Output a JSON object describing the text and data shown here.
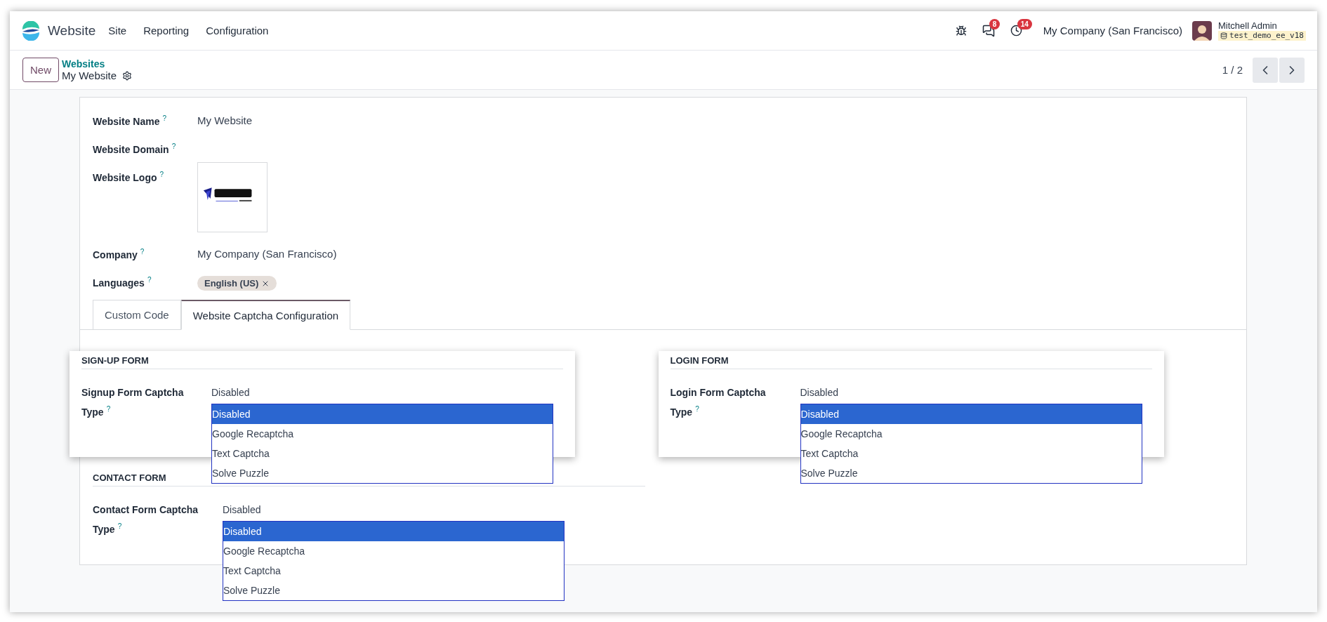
{
  "navbar": {
    "app_name": "Website",
    "menu": [
      "Site",
      "Reporting",
      "Configuration"
    ],
    "messages_badge": "8",
    "activities_badge": "14",
    "company": "My Company (San Francisco)",
    "user": {
      "name": "Mitchell Admin",
      "database": "test_demo_ee_v18"
    }
  },
  "control_panel": {
    "new_button": "New",
    "breadcrumb": "Websites",
    "record": "My Website",
    "pager": "1 / 2"
  },
  "fields": [
    {
      "kind": "text",
      "label": "Website Name",
      "help": "?",
      "value": "My Website"
    },
    {
      "kind": "text",
      "label": "Website Domain",
      "help": "?"
    },
    {
      "label": "Website Logo",
      "help": "?"
    },
    {
      "kind": "text",
      "label": "Company",
      "help": "?",
      "value": "My Company (San Francisco)"
    },
    {
      "kind": "tags",
      "label": "Languages",
      "help": "?",
      "tags": [
        "English (US)"
      ]
    }
  ],
  "tabs": [
    {
      "label": "Custom Code",
      "selected": false
    },
    {
      "label": "Website Captcha Configuration",
      "selected": true
    }
  ],
  "sections": [
    {
      "title": "SIGN-UP FORM",
      "raised": true,
      "label": "Signup Form Captcha",
      "label_end": "Type",
      "help": "?",
      "value": "Disabled",
      "options": [
        {
          "label": "Disabled",
          "selected": true
        },
        {
          "label": "Google Recaptcha",
          "selected": false
        },
        {
          "label": "Text Captcha",
          "selected": false
        },
        {
          "label": "Solve Puzzle",
          "selected": false
        }
      ]
    },
    {
      "title": "LOGIN FORM",
      "raised": true,
      "label": "Login Form Captcha",
      "label_end": "Type",
      "help": "?",
      "value": "Disabled",
      "options": [
        {
          "label": "Disabled",
          "selected": true
        },
        {
          "label": "Google Recaptcha",
          "selected": false
        },
        {
          "label": "Text Captcha",
          "selected": false
        },
        {
          "label": "Solve Puzzle",
          "selected": false
        }
      ]
    },
    {
      "title": "CONTACT FORM",
      "raised": false,
      "label": "Contact Form Captcha",
      "label_end": "Type",
      "help": "?",
      "value": "Disabled",
      "options": [
        {
          "label": "Disabled",
          "selected": true
        },
        {
          "label": "Google Recaptcha",
          "selected": false
        },
        {
          "label": "Text Captcha",
          "selected": false
        },
        {
          "label": "Solve Puzzle",
          "selected": false
        }
      ]
    }
  ]
}
